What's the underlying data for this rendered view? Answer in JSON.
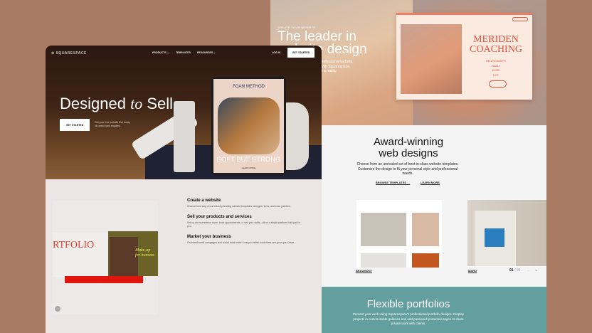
{
  "right_site": {
    "hero": {
      "kicker": "CREATE YOUR WEBSITE",
      "title_line1": "The leader in",
      "title_line2": "website design",
      "desc_line1": "professional website,",
      "desc_line2": "With Squarespace,",
      "desc_line3": "is a reality."
    },
    "meriden": {
      "title_line1": "MERIDEN",
      "title_line2": "COACHING",
      "nav": [
        "RELATIONSHIPS",
        "FAMILY",
        "WORK",
        "LIFE"
      ]
    },
    "award": {
      "title_line1": "Award-winning",
      "title_line2": "web designs",
      "desc": "Choose from an unrivaled set of best-in-class website templates. Customize the design to fit your personal style and professional needs.",
      "browse": "BROWSE TEMPLATES →",
      "learn": "LEARN MORE"
    },
    "templates": [
      {
        "name": "BEAUMONT"
      },
      {
        "name": "MARU"
      }
    ],
    "pager": {
      "current": "01",
      "total": "/ 05",
      "prev": "←",
      "next": "→"
    },
    "portfolios": {
      "title": "Flexible portfolios",
      "desc": "Present your work using Squarespace's professional portfolio designs. Display projects in customizable galleries and add password-protected pages to share private work with clients."
    }
  },
  "left_site": {
    "brand": "SQUARESPACE",
    "nav": [
      "PRODUCTS ⌄",
      "TEMPLATES",
      "RESOURCES ⌄"
    ],
    "login": "LOG IN",
    "get_started": "GET STARTED",
    "hero": {
      "title_a": "Designed",
      "title_b": "to",
      "title_c": "Sell",
      "cta": "GET STARTED",
      "note_line1": "Get your free website trial today.",
      "note_line2": "No credit card required."
    },
    "tablet": {
      "brand": "FOAM METHOD",
      "headline": "SOFT BUT STRONG",
      "cta": "LEARN MORE"
    },
    "features": [
      {
        "title": "Create a website",
        "desc": "Choose from any of our industry-leading website templates, designer fonts, and color palettes."
      },
      {
        "title": "Sell your products and services",
        "desc": "Set up an ecommerce store, book appointments, or sell your skills—all on a single platform built just for you."
      },
      {
        "title": "Market your business",
        "desc": "On-brand email campaigns and social tools make it easy to retain customers and grow your base."
      }
    ],
    "preview": {
      "portfolio_text": "RTFOLIO",
      "makeup_line1": "Make-up",
      "makeup_line2": "for humans"
    }
  }
}
